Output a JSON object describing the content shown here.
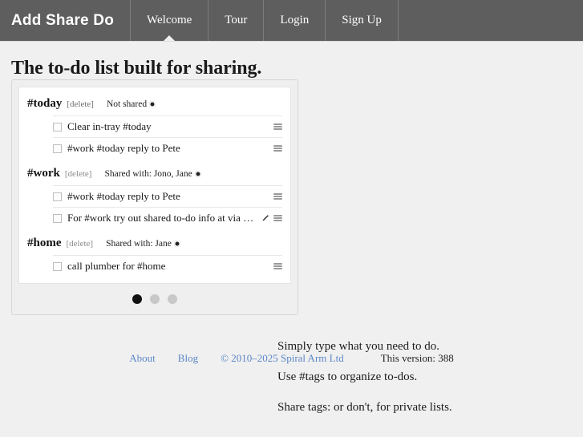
{
  "header": {
    "brand": "Add Share Do",
    "nav": [
      {
        "label": "Welcome",
        "active": true
      },
      {
        "label": "Tour",
        "active": false
      },
      {
        "label": "Login",
        "active": false
      },
      {
        "label": "Sign Up",
        "active": false
      }
    ]
  },
  "main": {
    "headline": "The to-do list built for sharing."
  },
  "screenshot_card": {
    "groups": [
      {
        "tag": "#today",
        "delete_label": "[delete]",
        "share_state": "Not shared",
        "items": [
          {
            "text": "Clear in-tray #today",
            "has_edit_icon": false
          },
          {
            "text": "#work #today reply to Pete",
            "has_edit_icon": false
          }
        ]
      },
      {
        "tag": "#work",
        "delete_label": "[delete]",
        "share_state": "Shared with: Jono, Jane",
        "items": [
          {
            "text": "#work #today reply to Pete",
            "has_edit_icon": false
          },
          {
            "text": "For #work try out shared to-do info at via http:/ …",
            "has_edit_icon": true
          }
        ]
      },
      {
        "tag": "#home",
        "delete_label": "[delete]",
        "share_state": "Shared with: Jane",
        "items": [
          {
            "text": "call plumber for #home",
            "has_edit_icon": false
          }
        ]
      }
    ],
    "carousel": {
      "dots": 3,
      "active_index": 0
    }
  },
  "features": [
    "Simply type what you need to do.",
    "Use #tags to organize to-dos.",
    "Share tags: or don't, for private lists."
  ],
  "footer": {
    "about": "About",
    "blog": "Blog",
    "copyright": "© 2010–2025 Spiral Arm Ltd",
    "version": "This version: 388"
  },
  "colors": {
    "navbar_bg": "#5e5e5e",
    "page_bg": "#f0f0f0",
    "link": "#5b87c7",
    "dot_active": "#111111",
    "dot_inactive": "#c8c8c8"
  }
}
